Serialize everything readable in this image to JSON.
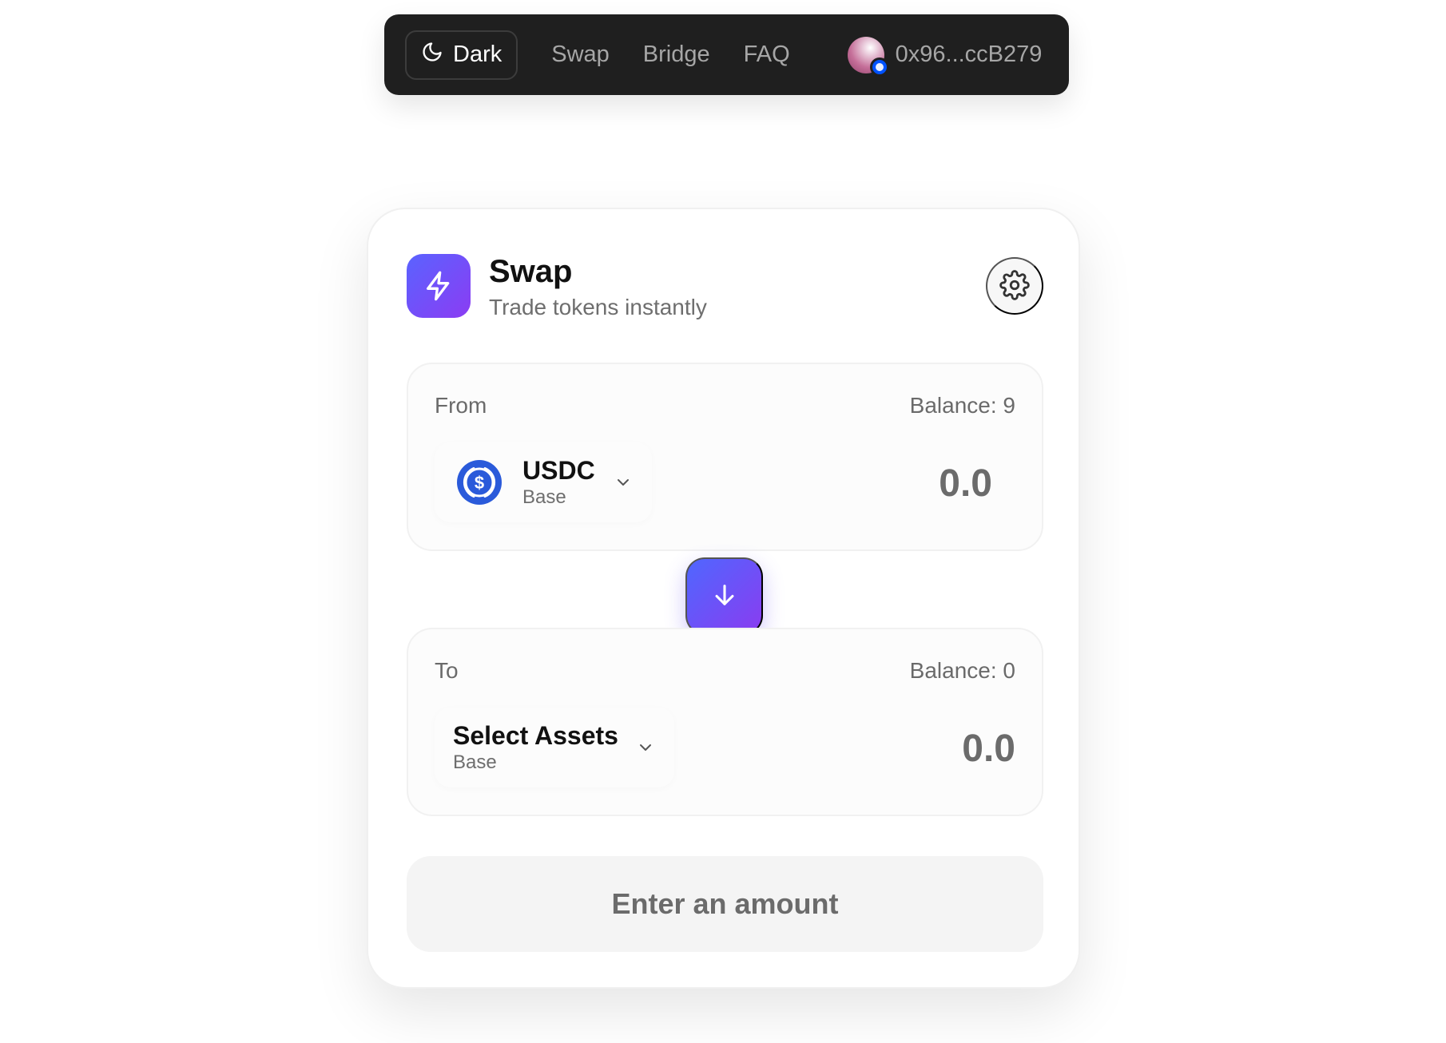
{
  "nav": {
    "theme_label": "Dark",
    "links": [
      "Swap",
      "Bridge",
      "FAQ"
    ],
    "address": "0x96...ccB279"
  },
  "card": {
    "title": "Swap",
    "subtitle": "Trade tokens instantly",
    "from": {
      "label": "From",
      "balance": "Balance: 9",
      "token_symbol": "USDC",
      "token_network": "Base",
      "token_icon": "usdc-icon",
      "amount": "0.0"
    },
    "to": {
      "label": "To",
      "balance": "Balance: 0",
      "token_symbol": "Select Assets",
      "token_network": "Base",
      "amount": "0.0"
    },
    "cta_label": "Enter an amount"
  },
  "colors": {
    "nav_bg": "#1f1f1f",
    "accent_start": "#5a63ff",
    "accent_end": "#8b3cf3",
    "usdc": "#2a5ada"
  }
}
